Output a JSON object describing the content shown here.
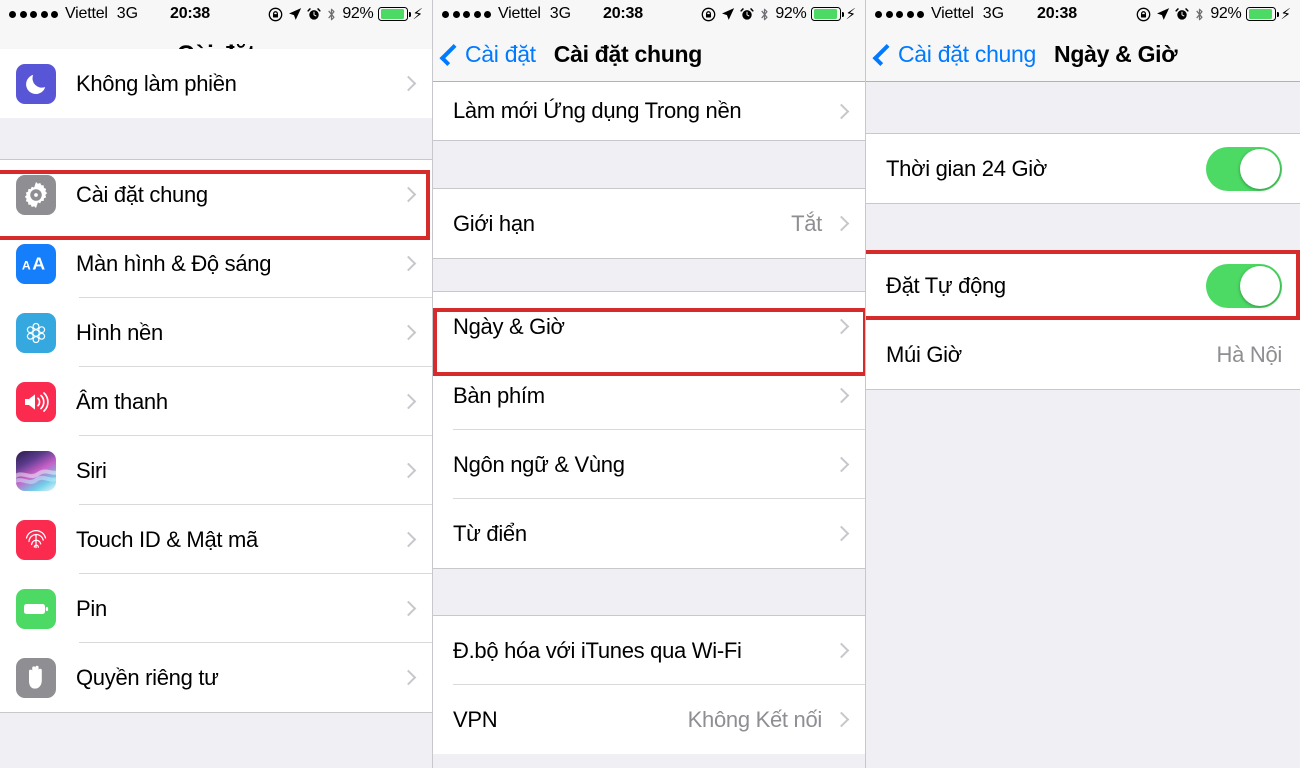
{
  "statusbar": {
    "signal_dots": 5,
    "carrier": "Viettel",
    "network": "3G",
    "time": "20:38",
    "battery_percent": "92%",
    "icons": [
      "rotation-lock-icon",
      "location-arrow-icon",
      "alarm-clock-icon",
      "bluetooth-icon"
    ],
    "charging": true
  },
  "colors": {
    "accent_blue": "#007aff",
    "toggle_green": "#4cd964",
    "highlight_red": "#d52b2b",
    "group_bg": "#efeff4",
    "value_gray": "#8e8e93"
  },
  "panel1": {
    "nav": {
      "title": "Cài đặt"
    },
    "rows": [
      {
        "label": "Không làm phiền",
        "icon": "do-not-disturb-icon",
        "accessory": "chevron"
      },
      {
        "label": "Cài đặt chung",
        "icon": "gear-icon",
        "accessory": "chevron",
        "highlighted": true
      },
      {
        "label": "Màn hình & Độ sáng",
        "icon": "display-brightness-icon",
        "accessory": "chevron"
      },
      {
        "label": "Hình nền",
        "icon": "wallpaper-icon",
        "accessory": "chevron"
      },
      {
        "label": "Âm thanh",
        "icon": "sound-icon",
        "accessory": "chevron"
      },
      {
        "label": "Siri",
        "icon": "siri-icon",
        "accessory": "chevron"
      },
      {
        "label": "Touch ID & Mật mã",
        "icon": "touch-id-icon",
        "accessory": "chevron"
      },
      {
        "label": "Pin",
        "icon": "battery-icon",
        "accessory": "chevron"
      },
      {
        "label": "Quyền riêng tư",
        "icon": "privacy-hand-icon",
        "accessory": "chevron"
      }
    ]
  },
  "panel2": {
    "nav": {
      "back_label": "Cài đặt",
      "title": "Cài đặt chung"
    },
    "rows": [
      {
        "label": "Làm mới Ứng dụng Trong nền",
        "accessory": "chevron"
      },
      {
        "label": "Giới hạn",
        "value": "Tắt",
        "accessory": "chevron"
      },
      {
        "label": "Ngày & Giờ",
        "accessory": "chevron",
        "highlighted": true
      },
      {
        "label": "Bàn phím",
        "accessory": "chevron"
      },
      {
        "label": "Ngôn ngữ & Vùng",
        "accessory": "chevron"
      },
      {
        "label": "Từ điển",
        "accessory": "chevron"
      },
      {
        "label": "Đ.bộ hóa với iTunes qua Wi-Fi",
        "accessory": "chevron"
      },
      {
        "label": "VPN",
        "value": "Không Kết nối",
        "accessory": "chevron"
      }
    ]
  },
  "panel3": {
    "nav": {
      "back_label": "Cài đặt chung",
      "title": "Ngày & Giờ"
    },
    "rows": [
      {
        "label": "Thời gian 24 Giờ",
        "accessory": "toggle",
        "toggle_on": true
      },
      {
        "label": "Đặt Tự động",
        "accessory": "toggle",
        "toggle_on": true,
        "highlighted": true
      },
      {
        "label": "Múi Giờ",
        "value": "Hà Nội",
        "accessory": "none"
      }
    ]
  }
}
